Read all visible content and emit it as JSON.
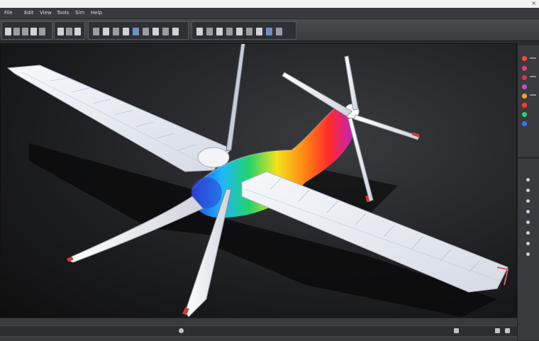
{
  "window": {
    "title": "​"
  },
  "menu": {
    "items": [
      "File",
      "Edit",
      "View",
      "Tools",
      "Sim",
      "Help"
    ]
  },
  "toolbar": {
    "groups": [
      "​",
      "​",
      "​",
      "​"
    ]
  },
  "viewport": {
    "model": "aircraft-stress-simulation",
    "colormap": [
      "#2a3fd6",
      "#1fb6ff",
      "#23d36b",
      "#f3e21a",
      "#ff8b12",
      "#ff2a2a",
      "#c020c8"
    ]
  },
  "rightpanel": {
    "swatches": [
      "#ff4a2e",
      "#e23c8a",
      "#d9364f",
      "#c74ae0",
      "#ff9e2a",
      "#ff3b2e",
      "#2fd16c",
      "#2f79ff"
    ]
  },
  "statusbar": {
    "text": "​"
  }
}
